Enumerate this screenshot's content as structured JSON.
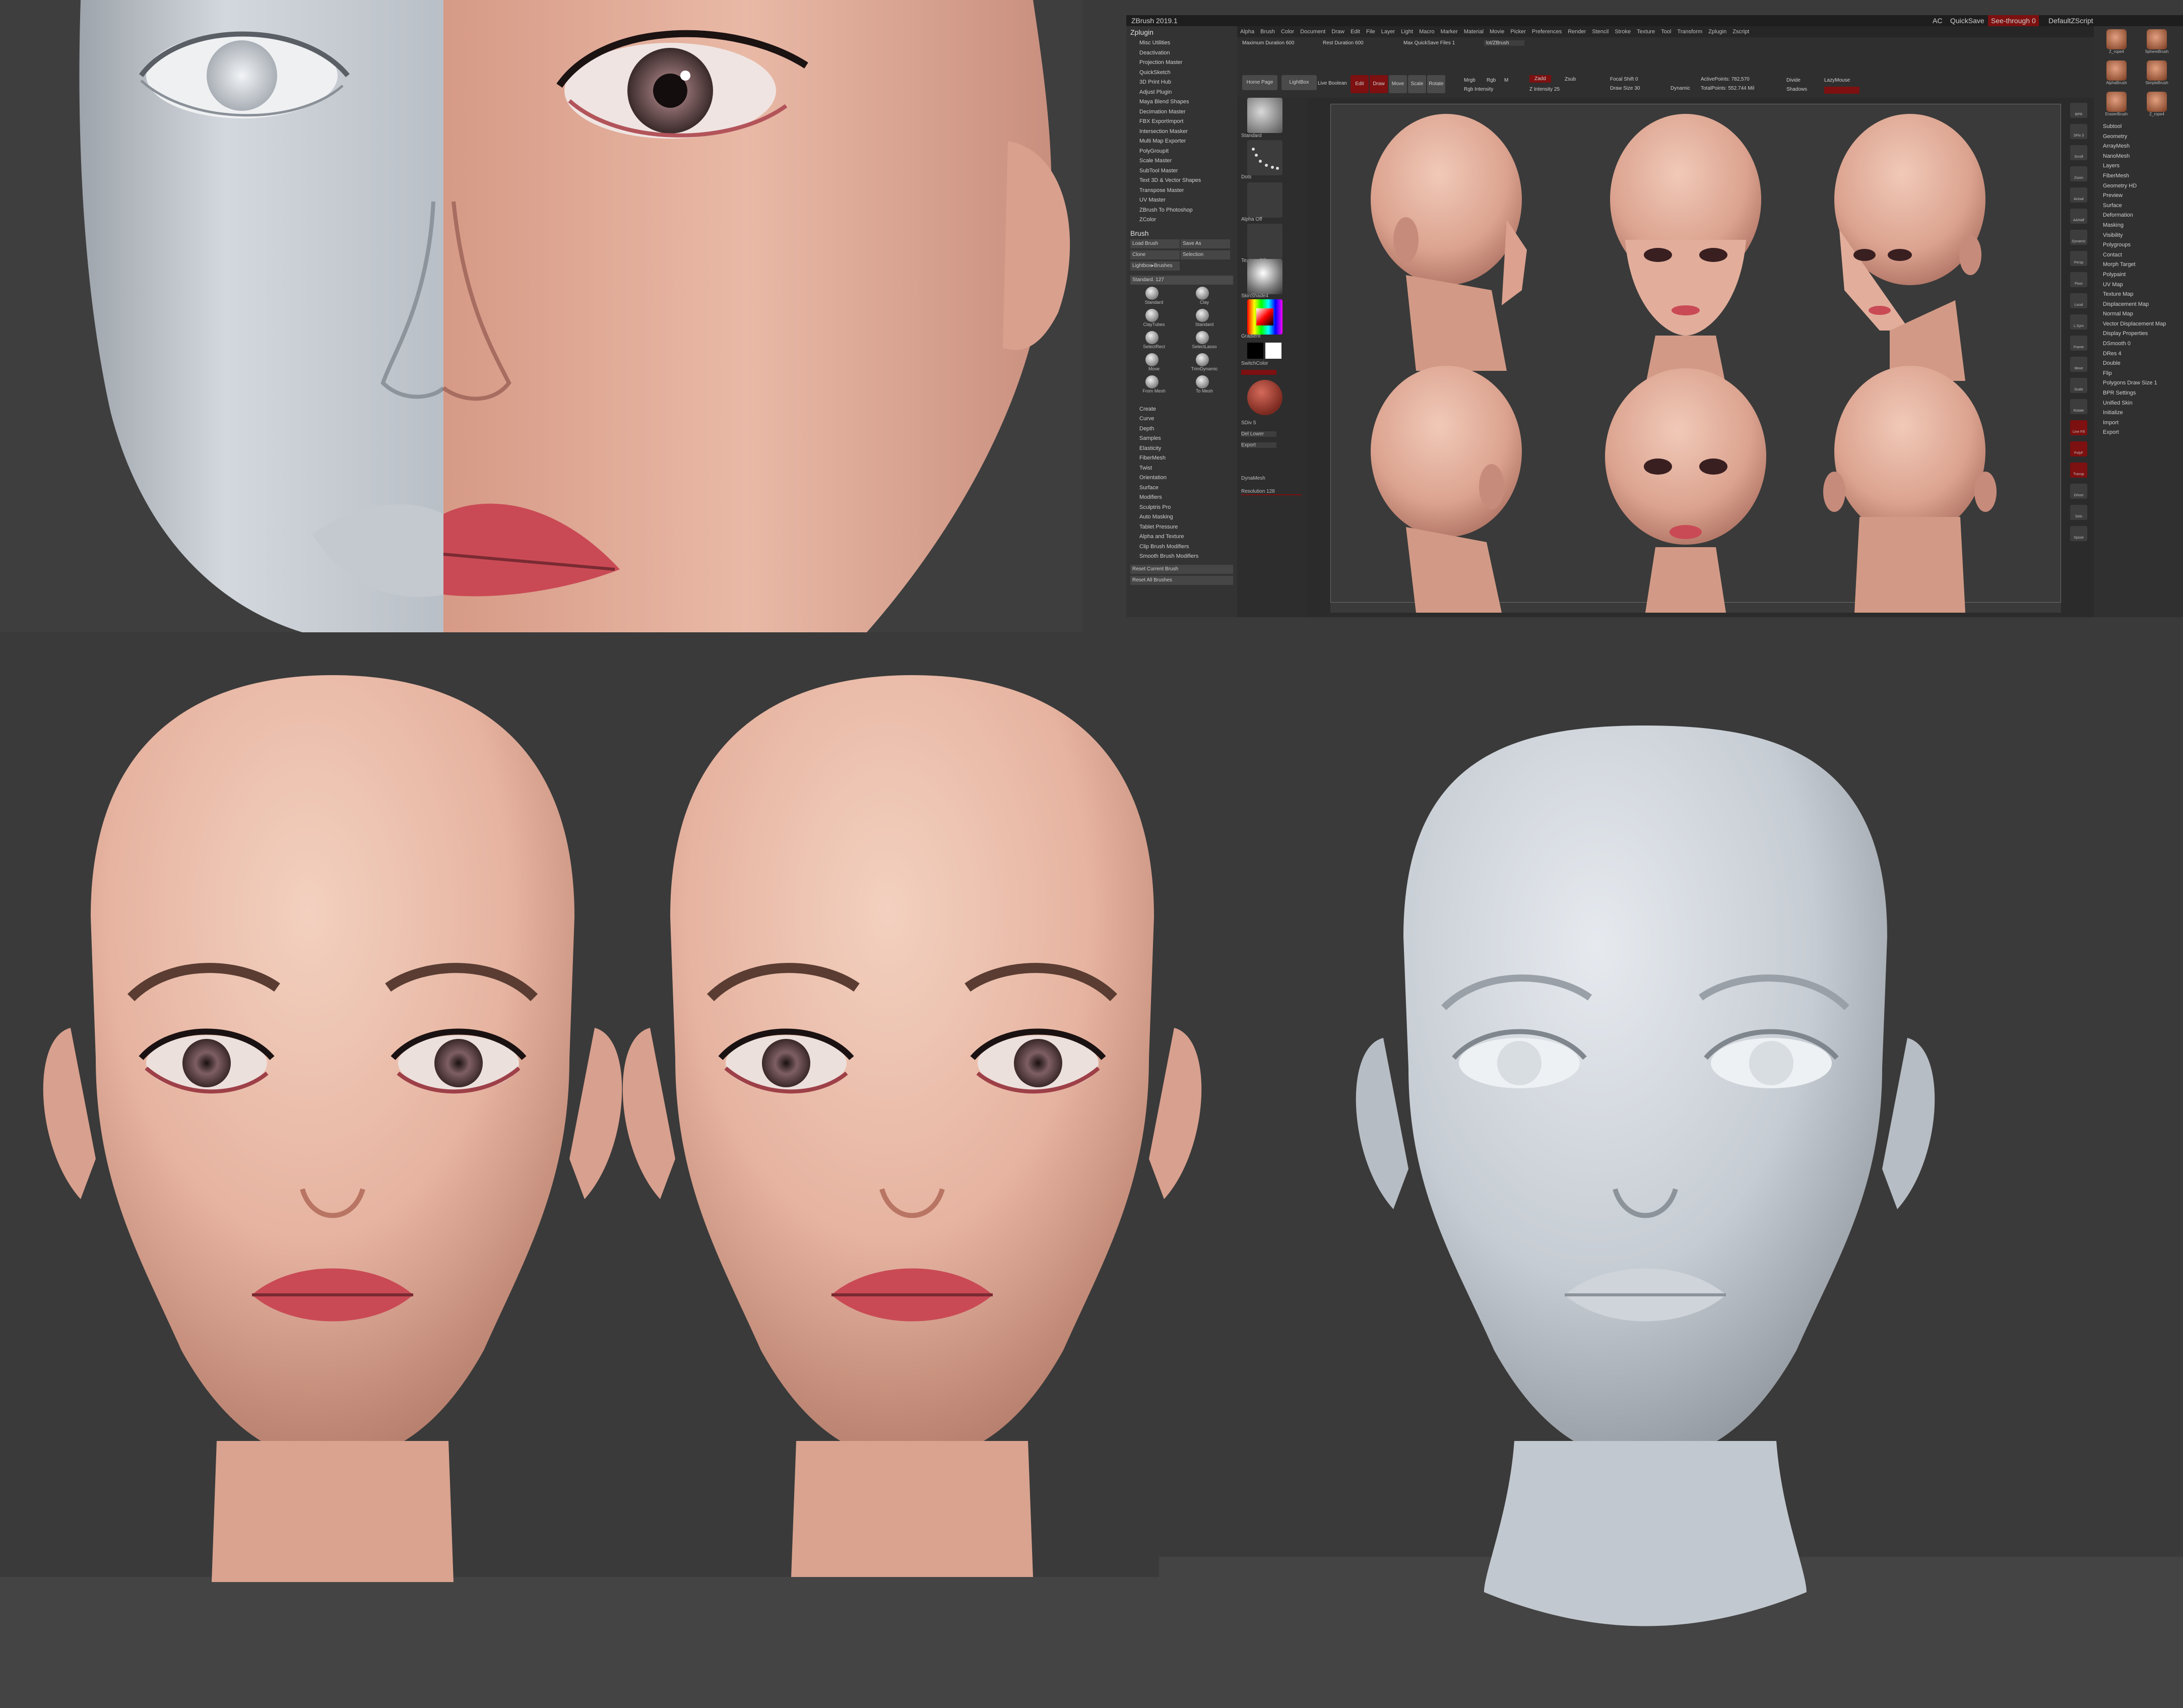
{
  "zbrush": {
    "title": "ZBrush 2019.1",
    "menus": [
      "Alpha",
      "Brush",
      "Color",
      "Document",
      "Draw",
      "Edit",
      "File",
      "Layer",
      "Light",
      "Macro",
      "Marker",
      "Material",
      "Movie",
      "Picker",
      "Preferences",
      "Render",
      "Stencil",
      "Stroke",
      "Texture",
      "Tool",
      "Transform",
      "Zplugin",
      "Zscript"
    ],
    "top_right": {
      "ac": "AC",
      "quicksave": "QuickSave",
      "seethrough": "See-through 0",
      "default_script": "DefaultZScript"
    },
    "shelf": {
      "max_duration": "Maximum Duration 600",
      "rest_duration": "Rest Duration 600",
      "max_quicksave_files": "Max QuickSave Files 1",
      "save_path": "lot/ZBrush",
      "home_page": "Home Page",
      "lightbox": "LightBox",
      "live_boolean": "Live Boolean",
      "edit": "Edit",
      "draw": "Draw",
      "move": "Move",
      "scale": "Scale",
      "rotate": "Rotate",
      "mrgb": "Mrgb",
      "rgb": "Rgb",
      "m": "M",
      "zadd": "Zadd",
      "zsub": "Zsub",
      "rgb_intensity": "Rgb Intensity",
      "z_intensity": "Z Intensity 25",
      "focal_shift": "Focal Shift 0",
      "draw_size": "Draw Size 30",
      "dynamic": "Dynamic",
      "active_points": "ActivePoints: 782,570",
      "total_points": "TotalPoints: 552.744 Mil",
      "divide": "Divide",
      "lazymouse": "LazyMouse",
      "shadows": "Shadows"
    },
    "left_tray": {
      "zplugin_header": "Zplugin",
      "zplugin_items": [
        "Misc Utilities",
        "Deactivation",
        "Projection Master",
        "QuickSketch",
        "3D Print Hub",
        "Adjust Plugin",
        "Maya Blend Shapes",
        "Decimation Master",
        "FBX ExportImport",
        "Intersection Masker",
        "Multi Map Exporter",
        "PolyGroupIt",
        "Scale Master",
        "SubTool Master",
        "Text 3D & Vector Shapes",
        "Transpose Master",
        "UV Master",
        "ZBrush To Photoshop",
        "ZColor"
      ],
      "brush_header": "Brush",
      "brush_buttons": [
        "Load Brush",
        "Save As",
        "Clone",
        "Selection",
        "Lightbox▸Brushes"
      ],
      "brush_current": "Standard. 127",
      "brush_icons": [
        "Standard",
        "Clay",
        "ClayTubes",
        "Standard",
        "SelectRect",
        "SelectLasso",
        "Move",
        "TrimDynamic",
        "From Mesh",
        "To Mesh"
      ],
      "brush_sub_items": [
        "Create",
        "Curve",
        "Depth",
        "Samples",
        "Elasticity",
        "FiberMesh",
        "Twist",
        "Orientation",
        "Surface",
        "Modifiers",
        "Sculptris Pro",
        "Auto Masking",
        "Tablet Pressure",
        "Alpha and Texture",
        "Clip Brush Modifiers",
        "Smooth Brush Modifiers"
      ],
      "reset_buttons": [
        "Reset Current Brush",
        "Reset All Brushes"
      ]
    },
    "palette": {
      "captions": [
        "Standard",
        "Dots",
        "Alpha Off",
        "Texture Off",
        "SkinShade4",
        "Gradient",
        "SwitchColor"
      ],
      "misc": [
        "SDiv 5",
        "Del Lower",
        "Export",
        "DynaMesh",
        "Resolution 128"
      ]
    },
    "right_tray": {
      "tool_thumbs": [
        "Z_rope4",
        "SphereBrush",
        "AlphaBrush",
        "SimpleBrush",
        "EraserBrush",
        "Z_rope4"
      ],
      "items": [
        "Subtool",
        "Geometry",
        "ArrayMesh",
        "NanoMesh",
        "Layers",
        "FiberMesh",
        "Geometry HD",
        "Preview",
        "Surface",
        "Deformation",
        "Masking",
        "Visibility",
        "Polygroups",
        "Contact",
        "Morph Target",
        "Polypaint",
        "UV Map",
        "Texture Map",
        "Displacement Map",
        "Normal Map",
        "Vector Displacement Map",
        "Display Properties",
        "DSmooth 0",
        "DRes 4",
        "Double",
        "Flip",
        "Polygons Draw Size 1",
        "BPR Settings",
        "Unified Skin",
        "Initialize",
        "Import",
        "Export"
      ]
    },
    "right_icons": [
      "BPR",
      "SPix 3",
      "Scroll",
      "Zoom",
      "Actual",
      "AAHalf",
      "Dynamic",
      "Persp",
      "Floor",
      "Local",
      "L.Sym",
      "Frame",
      "Move",
      "Scale",
      "Rotate",
      "Line Fill",
      "PolyF",
      "Transp",
      "Ghost",
      "Solo",
      "Xpose"
    ]
  },
  "colors": {
    "bg": "#3a3a3a",
    "skin": "#e7b7a5",
    "clay": "#c9d0d8",
    "lip": "#c94a55",
    "accent_red": "#7d1010"
  }
}
